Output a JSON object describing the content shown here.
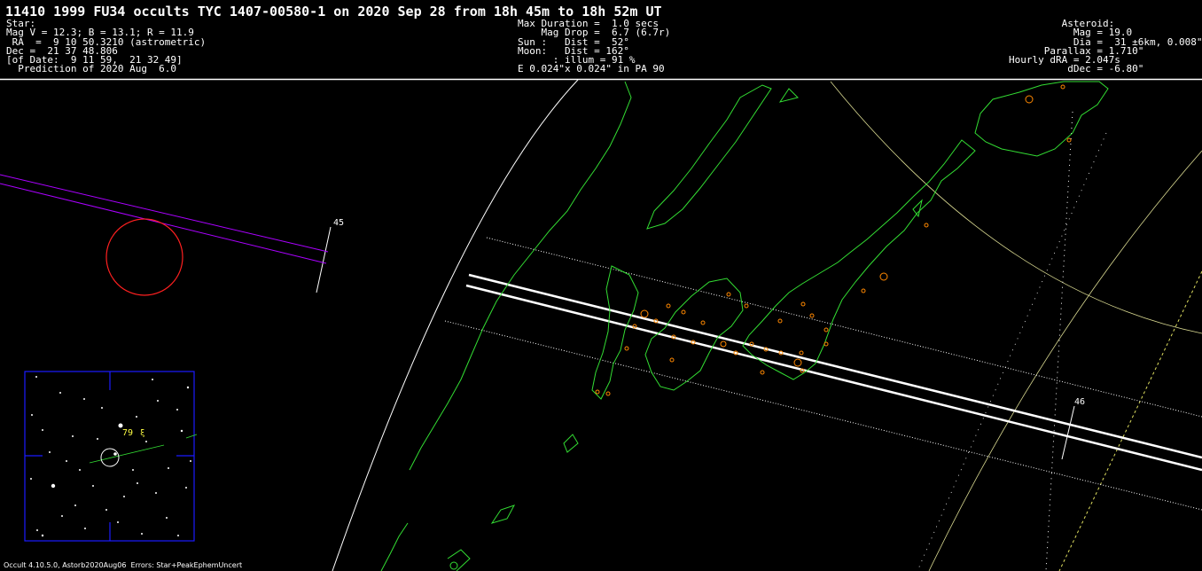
{
  "header": {
    "title": "11410 1999 FU34 occults TYC 1407-00580-1 on 2020 Sep 28 from 18h 45m to 18h 52m UT",
    "star_lines": [
      "Star:",
      "Mag V = 12.3; B = 13.1; R = 11.9",
      " RA  =  9 10 50.3210 (astrometric)",
      "Dec =  21 37 48.806",
      "[of Date:  9 11 59,  21 32 49]",
      "  Prediction of 2020 Aug  6.0"
    ],
    "event_lines": [
      "Max Duration =  1.0 secs",
      "    Mag Drop =  6.7 (6.7r)",
      "Sun :   Dist =  52°",
      "Moon:   Dist = 162°",
      "      : illum = 91 %",
      "E 0.024\"x 0.024\" in PA 90"
    ],
    "asteroid_lines": [
      "         Asteroid:",
      "           Mag = 19.0",
      "           Dia =  31 ±6km, 0.008\"",
      "      Parallax = 1.710\"",
      "Hourly dRA = 2.047s",
      "          dDec = -6.80\""
    ]
  },
  "time_marks": [
    "45",
    "46"
  ],
  "starchart_label": "79",
  "footer": "Occult 4.10.5.0, Astorb2020Aug06  Errors: Star+PeakEphemUncert",
  "colors": {
    "coastline": "#33dd33",
    "path": "#ffffff",
    "sites": "#ff8800",
    "track": "#aa00ff",
    "sun_circle": "#ff2020",
    "starchart_frame": "#1a1aff",
    "graticule": "#d8d890"
  }
}
